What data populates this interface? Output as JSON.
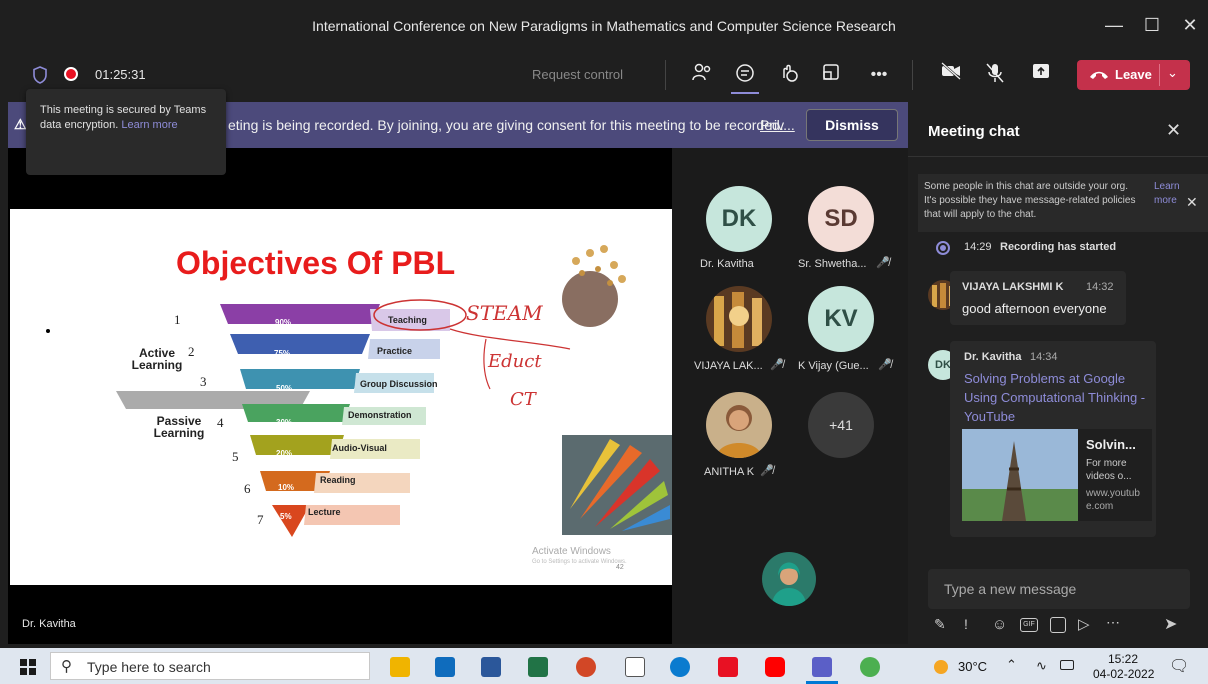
{
  "window": {
    "title": "International Conference on New Paradigms in Mathematics and Computer Science Research"
  },
  "toolbar": {
    "timer": "01:25:31",
    "request_control": "Request control",
    "leave": "Leave"
  },
  "tooltip": {
    "text": "This meeting is secured by Teams data encryption.",
    "link": "Learn more"
  },
  "banner": {
    "text": "eting is being recorded. By joining, you are giving consent for this meeting to be recorded.",
    "link": "Priv...",
    "dismiss": "Dismiss"
  },
  "slide": {
    "title": "Objectives Of PBL",
    "levels": [
      {
        "num": "1",
        "pct": "90%",
        "label": "Teaching"
      },
      {
        "num": "2",
        "pct": "75%",
        "label": "Practice"
      },
      {
        "num": "3",
        "pct": "50%",
        "label": "Group Discussion"
      },
      {
        "num": "4",
        "pct": "30%",
        "label": "Demonstration"
      },
      {
        "num": "5",
        "pct": "20%",
        "label": "Audio-Visual"
      },
      {
        "num": "6",
        "pct": "10%",
        "label": "Reading"
      },
      {
        "num": "7",
        "pct": "5%",
        "label": "Lecture"
      }
    ],
    "active_learning": "Active Learning",
    "passive_learning": "Passive Learning",
    "handwriting": [
      "STEAM",
      "Educt",
      "CT"
    ],
    "watermark": "Activate Windows",
    "watermark_sub": "Go to Settings to activate Windows.",
    "page": "42"
  },
  "presenter": "Dr. Kavitha",
  "participants": [
    {
      "initials": "DK",
      "name": "Dr. Kavitha",
      "muted": false,
      "bg": "#c6e6dc",
      "fg": "#2f4f46"
    },
    {
      "initials": "SD",
      "name": "Sr. Shwetha...",
      "muted": true,
      "bg": "#f3ddd7",
      "fg": "#5a3a33"
    },
    {
      "initials": "",
      "name": "VIJAYA LAK...",
      "muted": true,
      "bg": "#7a4a2a",
      "fg": "#fff"
    },
    {
      "initials": "KV",
      "name": "K Vijay (Gue...",
      "muted": true,
      "bg": "#c6e6dc",
      "fg": "#2f4f46"
    },
    {
      "initials": "",
      "name": "ANITHA K",
      "muted": true,
      "bg": "#b98a6a",
      "fg": "#fff"
    },
    {
      "initials": "+41",
      "name": "",
      "muted": false,
      "bg": "#3a3a3a",
      "fg": "#ddd"
    }
  ],
  "chat": {
    "title": "Meeting chat",
    "notice": "Some people in this chat are outside your org. It's possible they have message-related policies that will apply to the chat.",
    "notice_link": "Learn more",
    "system_time": "14:29",
    "system_text": "Recording has started",
    "messages": [
      {
        "author": "VIJAYA LAKSHMI K",
        "time": "14:32",
        "text": "good afternoon everyone"
      },
      {
        "author": "Dr. Kavitha",
        "time": "14:34",
        "link": "Solving Problems at Google Using Computational Thinking - YouTube",
        "card_title": "Solvin...",
        "card_desc": "For more videos o...",
        "card_url": "www.youtube.com"
      }
    ],
    "compose_placeholder": "Type a new message"
  },
  "taskbar": {
    "search": "Type here to search",
    "temp": "30°C",
    "time": "15:22",
    "date": "04-02-2022"
  }
}
